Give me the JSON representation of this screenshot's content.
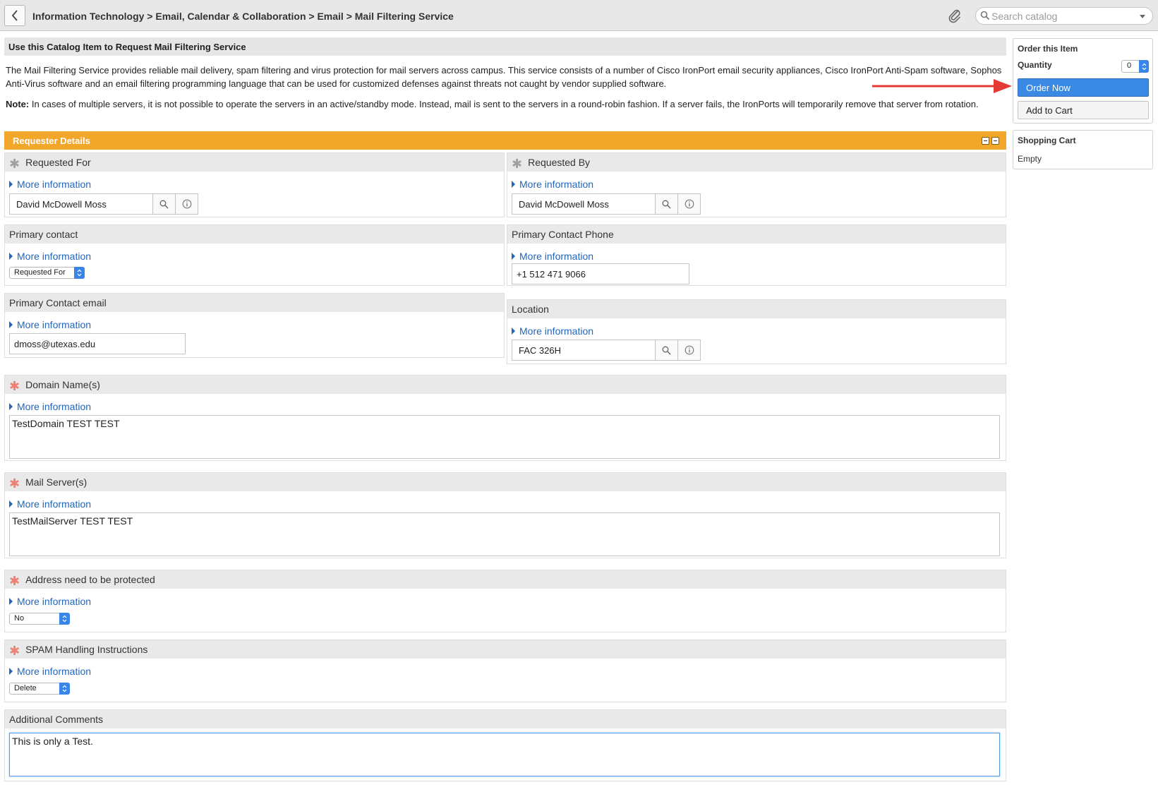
{
  "breadcrumb": "Information Technology > Email, Calendar & Collaboration > Email > Mail Filtering Service",
  "search": {
    "placeholder": "Search catalog"
  },
  "intro": {
    "title": "Use this Catalog Item to Request Mail Filtering Service",
    "body": "The Mail Filtering Service provides reliable mail delivery, spam filtering and virus protection for mail servers across campus. This service consists of a number of Cisco IronPort email security appliances, Cisco IronPort Anti-Spam software, Sophos Anti-Virus software and an email filtering programming language that can be used for customized defenses against threats not caught by vendor supplied software.",
    "note_label": "Note:",
    "note_body": " In cases of multiple servers, it is not possible to operate the servers in an active/standby mode. Instead, mail is sent to the servers in a round-robin fashion. If a server fails, the IronPorts will temporarily remove that server from rotation."
  },
  "section": {
    "title": "Requester Details"
  },
  "more_info": "More information",
  "fields": {
    "requested_for": {
      "label": "Requested For",
      "value": "David McDowell Moss"
    },
    "requested_by": {
      "label": "Requested By",
      "value": "David McDowell Moss"
    },
    "primary_contact": {
      "label": "Primary contact",
      "value": "Requested For"
    },
    "primary_phone": {
      "label": "Primary Contact Phone",
      "value": "+1 512 471 9066"
    },
    "primary_email": {
      "label": "Primary Contact email",
      "value": "dmoss@utexas.edu"
    },
    "location": {
      "label": "Location",
      "value": "FAC 326H"
    },
    "domain_names": {
      "label": "Domain Name(s)",
      "value": "TestDomain TEST TEST"
    },
    "mail_servers": {
      "label": "Mail Server(s)",
      "value": "TestMailServer TEST TEST"
    },
    "address_protected": {
      "label": "Address need to be protected",
      "value": "No"
    },
    "spam_handling": {
      "label": "SPAM Handling Instructions",
      "value": "Delete"
    },
    "comments": {
      "label": "Additional Comments",
      "value": "This is only a Test."
    }
  },
  "order": {
    "title": "Order this Item",
    "quantity_label": "Quantity",
    "quantity": "0",
    "order_now": "Order Now",
    "add_to_cart": "Add to Cart"
  },
  "cart": {
    "title": "Shopping Cart",
    "status": "Empty"
  },
  "colors": {
    "section_header": "#f2a62a",
    "link": "#2266bb",
    "primary_button": "#3a8ae5",
    "required_star": "#f08070",
    "annotation_arrow": "#e53935"
  },
  "icons": {
    "back": "chevron-left-icon",
    "attachment": "paperclip-icon",
    "search": "search-icon",
    "reference_lookup": "magnifier-icon",
    "reference_info": "info-icon"
  }
}
